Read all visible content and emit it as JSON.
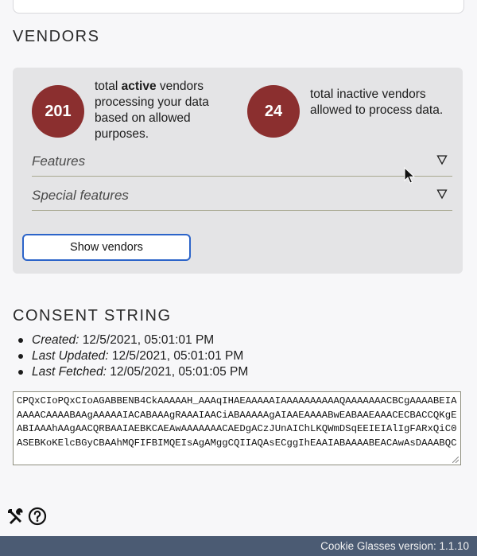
{
  "vendors": {
    "title": "VENDORS",
    "active_count": "201",
    "active_text_pre": "total ",
    "active_text_bold": "active",
    "active_text_post": " vendors processing your data based on allowed purposes.",
    "inactive_count": "24",
    "inactive_text": "total inactive vendors allowed to process data.",
    "accordions": [
      {
        "label": "Features"
      },
      {
        "label": "Special features"
      }
    ],
    "show_button_label": "Show vendors"
  },
  "consent": {
    "title": "CONSENT STRING",
    "items": [
      {
        "key": "Created:",
        "value": " 12/5/2021, 05:01:01 PM"
      },
      {
        "key": "Last Updated:",
        "value": " 12/5/2021, 05:01:01 PM"
      },
      {
        "key": "Last Fetched:",
        "value": " 12/05/2021, 05:01:05 PM"
      }
    ],
    "string": "CPQxCIoPQxCIoAGABBENB4CkAAAAAH_AAAqIHAEAAAAAIAAAAAAAAAAQAAAAAAACBCgAAAABEIAAAAACAAAABAAgAAAAAIACABAAAgRAAAIAACiABAAAAAgAIAAEAAAABwEABAAEAAACECBACCQKgEABIAAAhAAgAACQRBAAIAEBKCAEAwAAAAAAACAEDgACzJUnAIChLKQWmDSqEEIEIAlIgFARxQiC0ASEBKoKElcBGyCBAAhMQFIFBIMQEIsAgAMggCQIIAQAsECggIhEAAIABAAAABEACAwAsDAAABQC"
  },
  "footer": {
    "version_text": "Cookie Glasses version: 1.1.10"
  },
  "icons": {
    "tools": "tools-icon",
    "help": "help-icon",
    "dropdown": "triangle-down-icon"
  },
  "colors": {
    "stat_circle": "#8b2f2f",
    "card_bg": "#e4e4e6",
    "button_border": "#2c64c9",
    "footer_bg": "#4b5b73"
  }
}
